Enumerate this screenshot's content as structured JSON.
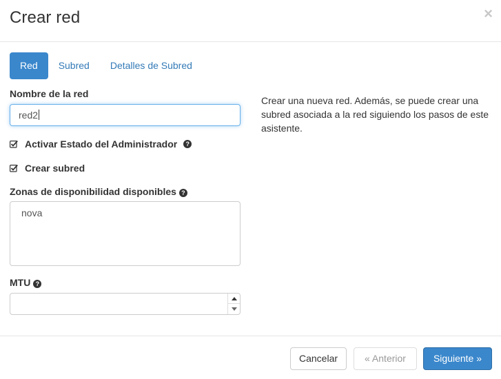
{
  "modal": {
    "title": "Crear red",
    "close_symbol": "×"
  },
  "tabs": [
    {
      "label": "Red",
      "active": true
    },
    {
      "label": "Subred",
      "active": false
    },
    {
      "label": "Detalles de Subred",
      "active": false
    }
  ],
  "form": {
    "network_name": {
      "label": "Nombre de la red",
      "value": "red2"
    },
    "admin_state": {
      "label": "Activar Estado del Administrador",
      "checked": true,
      "help_icon": "question-circle-icon"
    },
    "create_subnet": {
      "label": "Crear subred",
      "checked": true
    },
    "availability_zones": {
      "label": "Zonas de disponibilidad disponibles",
      "options": [
        "nova"
      ],
      "help_icon": "question-circle-icon"
    },
    "mtu": {
      "label": "MTU",
      "value": "",
      "help_icon": "question-circle-icon"
    }
  },
  "description": "Crear una nueva red. Además, se puede crear una subred asociada a la red siguiendo los pasos de este asistente.",
  "footer": {
    "cancel_label": "Cancelar",
    "back_label": "« Anterior",
    "next_label": "Siguiente »"
  },
  "colors": {
    "primary": "#3a87cc",
    "link": "#337ab7",
    "focus_border": "#66afe9"
  },
  "help_symbol": "?"
}
